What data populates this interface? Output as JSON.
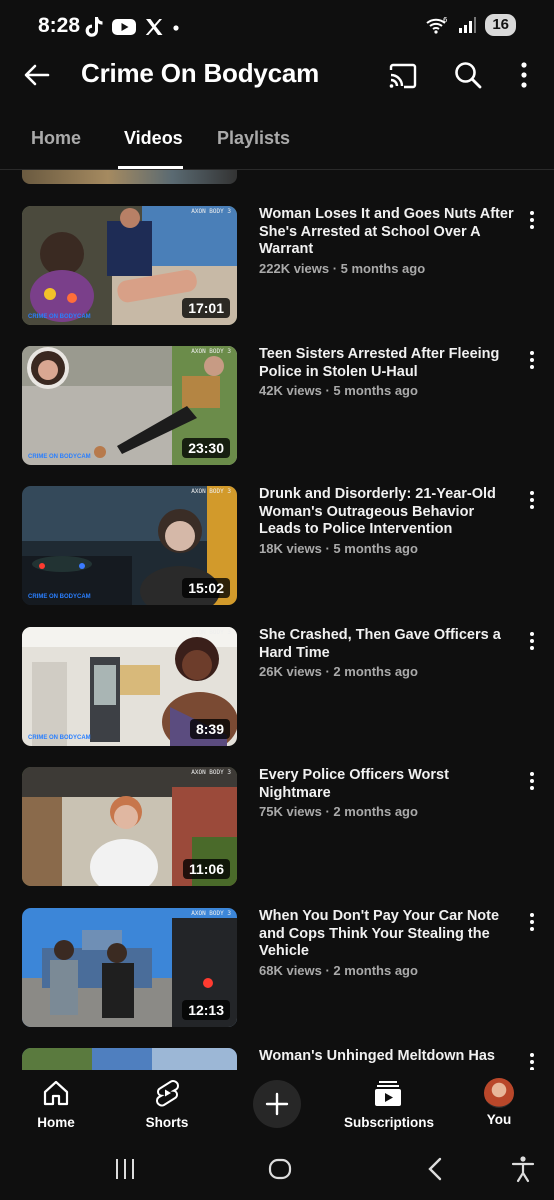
{
  "status": {
    "time": "8:28",
    "battery": "16"
  },
  "header": {
    "title": "Crime On Bodycam"
  },
  "tabs": [
    {
      "label": "Home"
    },
    {
      "label": "Videos"
    },
    {
      "label": "Playlists"
    }
  ],
  "videos": [
    {
      "title": "Woman Loses It and Goes Nuts After She's Arrested at School Over A Warrant",
      "stats": "222K views · 5 months ago",
      "duration": "17:01"
    },
    {
      "title": "Teen Sisters Arrested After Fleeing Police in Stolen U-Haul",
      "stats": "42K views · 5 months ago",
      "duration": "23:30"
    },
    {
      "title": "Drunk and Disorderly: 21-Year-Old Woman's Outrageous Behavior Leads to Police Intervention",
      "stats": "18K views · 5 months ago",
      "duration": "15:02"
    },
    {
      "title": "She Crashed, Then Gave Officers a Hard Time",
      "stats": "26K views · 2 months ago",
      "duration": "8:39"
    },
    {
      "title": "Every Police Officers Worst Nightmare",
      "stats": "75K views · 2 months ago",
      "duration": "11:06"
    },
    {
      "title": "When You Don't Pay Your Car Note and Cops Think Your Stealing the Vehicle",
      "stats": "68K views · 2 months ago",
      "duration": "12:13"
    },
    {
      "title": "Woman's Unhinged Meltdown Has",
      "stats": "",
      "duration": ""
    }
  ],
  "bottom_nav": {
    "home": "Home",
    "shorts": "Shorts",
    "subscriptions": "Subscriptions",
    "you": "You"
  },
  "watermark": "CRIME ON BODYCAM",
  "colors": {
    "background": "#0f0f0f",
    "text_primary": "#f1f1f1",
    "text_secondary": "#aaaaaa"
  }
}
